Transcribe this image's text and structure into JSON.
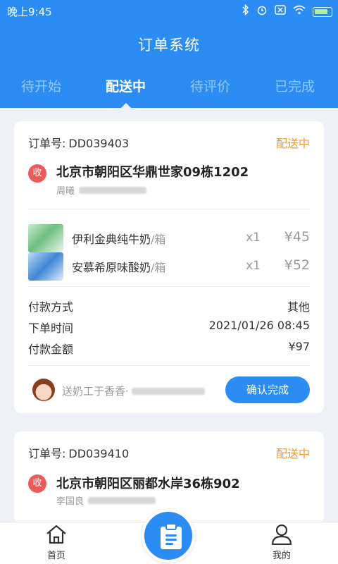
{
  "status_bar": {
    "time": "晚上9:45"
  },
  "header": {
    "title": "订单系统",
    "tabs": [
      {
        "label": "待开始"
      },
      {
        "label": "配送中"
      },
      {
        "label": "待评价"
      },
      {
        "label": "已完成"
      }
    ],
    "active_tab": "配送中"
  },
  "orders": [
    {
      "order_label": "订单号:",
      "order_no": "DD039403",
      "status": "配送中",
      "badge": "收",
      "address": "北京市朝阳区华鼎世家09栋1202",
      "receiver": "周曦",
      "items": [
        {
          "name": "伊利金典纯牛奶",
          "unit": "/箱",
          "qty": "x1",
          "price": "¥45"
        },
        {
          "name": "安慕希原味酸奶",
          "unit": "/箱",
          "qty": "x1",
          "price": "¥52"
        }
      ],
      "info": [
        {
          "label": "付款方式",
          "value": "其他"
        },
        {
          "label": "下单时间",
          "value": "2021/01/26 08:45"
        },
        {
          "label": "付款金额",
          "value": "¥97"
        }
      ],
      "courier": "送奶工于香香·",
      "confirm_label": "确认完成"
    },
    {
      "order_label": "订单号:",
      "order_no": "DD039410",
      "status": "配送中",
      "badge": "收",
      "address": "北京市朝阳区丽都水岸36栋902",
      "receiver": "李国良"
    }
  ],
  "bottom_nav": {
    "home_label": "首页",
    "mine_label": "我的"
  },
  "colors": {
    "primary": "#2b8cf3",
    "status_orange": "#f29a2e",
    "badge_red": "#ec5a5a",
    "background": "#eef1f6"
  }
}
